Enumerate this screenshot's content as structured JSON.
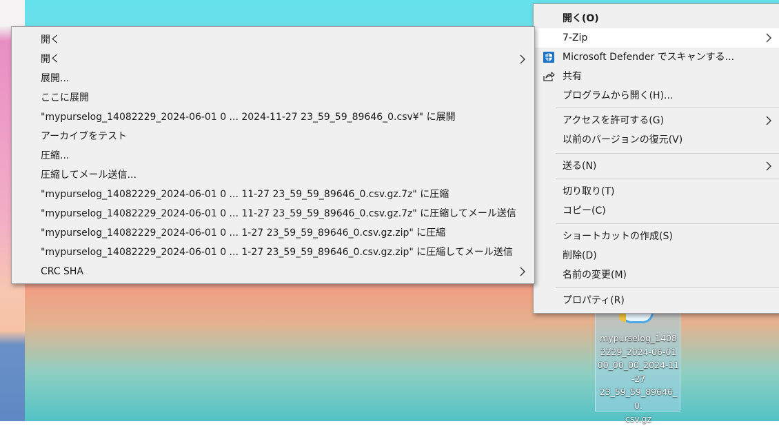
{
  "main_menu": {
    "items": [
      {
        "label": "開く(O)"
      },
      {
        "label": "7-Zip"
      },
      {
        "label": "Microsoft Defender でスキャンする..."
      },
      {
        "label": "共有"
      },
      {
        "label": "プログラムから開く(H)..."
      },
      {
        "label": "アクセスを許可する(G)"
      },
      {
        "label": "以前のバージョンの復元(V)"
      },
      {
        "label": "送る(N)"
      },
      {
        "label": "切り取り(T)"
      },
      {
        "label": "コピー(C)"
      },
      {
        "label": "ショートカットの作成(S)"
      },
      {
        "label": "削除(D)"
      },
      {
        "label": "名前の変更(M)"
      },
      {
        "label": "プロパティ(R)"
      }
    ]
  },
  "submenu_7zip": {
    "items": [
      {
        "label": "開く"
      },
      {
        "label": "開く"
      },
      {
        "label": "展開..."
      },
      {
        "label": "ここに展開"
      },
      {
        "label": "\"mypurselog_14082229_2024-06-01 0 ... 2024-11-27 23_59_59_89646_0.csv¥\" に展開"
      },
      {
        "label": "アーカイブをテスト"
      },
      {
        "label": "圧縮..."
      },
      {
        "label": "圧縮してメール送信..."
      },
      {
        "label": "\"mypurselog_14082229_2024-06-01 0 ... 11-27 23_59_59_89646_0.csv.gz.7z\" に圧縮"
      },
      {
        "label": "\"mypurselog_14082229_2024-06-01 0 ... 11-27 23_59_59_89646_0.csv.gz.7z\" に圧縮してメール送信"
      },
      {
        "label": "\"mypurselog_14082229_2024-06-01 0 ... 1-27 23_59_59_89646_0.csv.gz.zip\" に圧縮"
      },
      {
        "label": "\"mypurselog_14082229_2024-06-01 0 ... 1-27 23_59_59_89646_0.csv.gz.zip\" に圧縮してメール送信"
      },
      {
        "label": "CRC SHA"
      }
    ]
  },
  "desktop_file": {
    "name": "mypurselog_14082229_2024-06-01 00_00_00_2024-11-27 23_59_59_89646_0.csv.gz",
    "name_lines": [
      "mypurselog_1408",
      "2229_2024-06-01",
      "00_00_00_2024-11",
      "-27",
      "23_59_59_89646_0.",
      "csv.gz"
    ]
  },
  "colors": {
    "menu_background": "#f0f0f0",
    "menu_highlight": "#ffffff",
    "defender_blue": "#1a73c8"
  },
  "icons": {
    "defender": "shield-icon",
    "share": "share-icon",
    "submenu_arrow": "chevron-right-icon"
  }
}
